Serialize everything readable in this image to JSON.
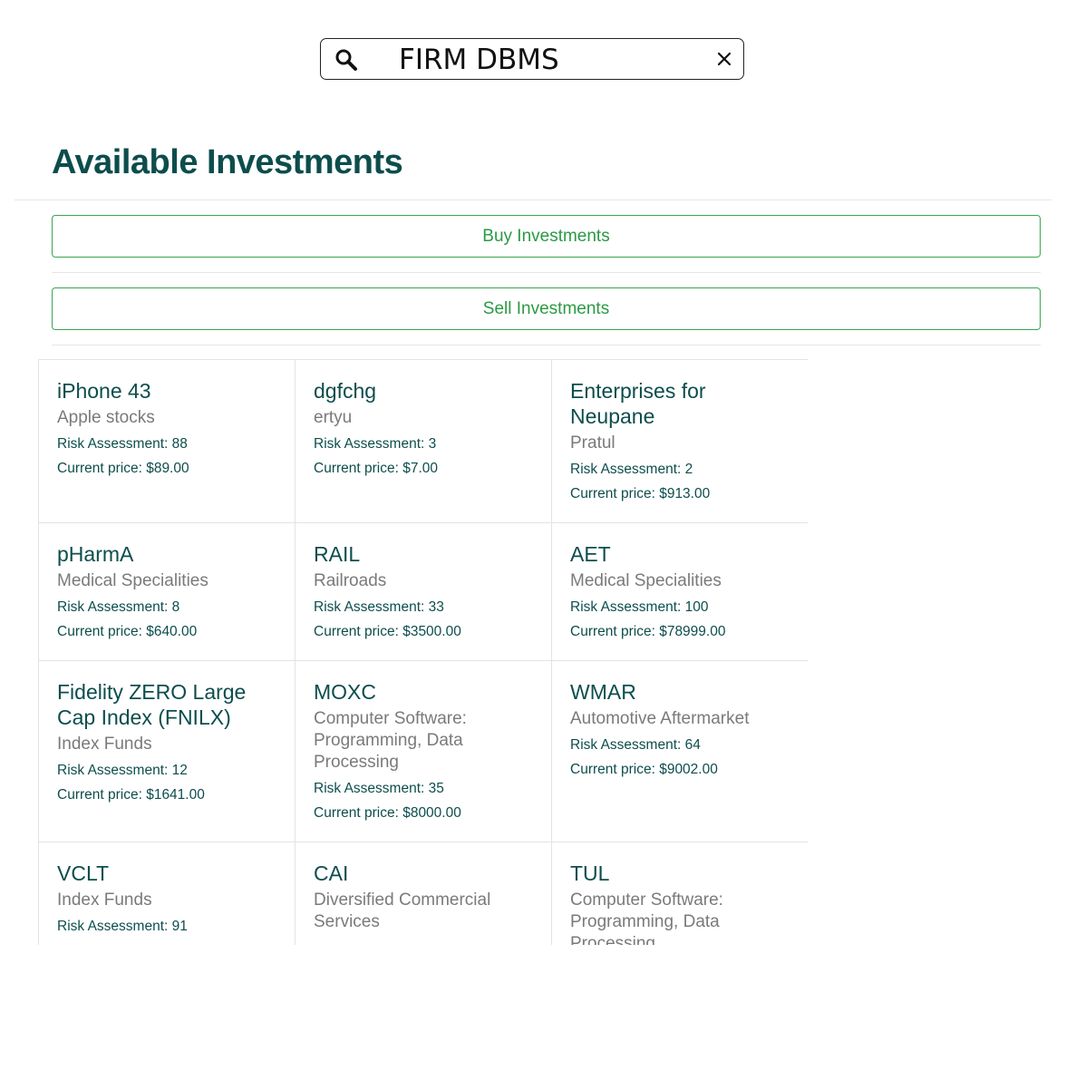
{
  "search": {
    "value": "FIRM DBMS",
    "icon": "search-icon",
    "clear_icon": "close-icon"
  },
  "page": {
    "title": "Available Investments",
    "buy_label": "Buy Investments",
    "sell_label": "Sell Investments"
  },
  "colors": {
    "title": "#0d4d4d",
    "button_accent": "#2a9a44",
    "subtitle": "#7a7a7a"
  },
  "investments": [
    {
      "name": "iPhone 43",
      "category": "Apple stocks",
      "risk": "Risk Assessment: 88",
      "price": "Current price: $89.00"
    },
    {
      "name": "dgfchg",
      "category": "ertyu",
      "risk": "Risk Assessment: 3",
      "price": "Current price: $7.00"
    },
    {
      "name": "Enterprises for Neupane",
      "category": "Pratul",
      "risk": "Risk Assessment: 2",
      "price": "Current price: $913.00"
    },
    {
      "name": "pHarmA",
      "category": "Medical Specialities",
      "risk": "Risk Assessment: 8",
      "price": "Current price: $640.00"
    },
    {
      "name": "RAIL",
      "category": "Railroads",
      "risk": "Risk Assessment: 33",
      "price": "Current price: $3500.00"
    },
    {
      "name": "AET",
      "category": "Medical Specialities",
      "risk": "Risk Assessment: 100",
      "price": "Current price: $78999.00"
    },
    {
      "name": "Fidelity ZERO Large Cap Index (FNILX)",
      "category": "Index Funds",
      "risk": "Risk Assessment: 12",
      "price": "Current price: $1641.00"
    },
    {
      "name": "MOXC",
      "category": "Computer Software: Programming, Data Processing",
      "risk": "Risk Assessment: 35",
      "price": "Current price: $8000.00"
    },
    {
      "name": "WMAR",
      "category": "Automotive Aftermarket",
      "risk": "Risk Assessment: 64",
      "price": "Current price: $9002.00"
    },
    {
      "name": "VCLT",
      "category": "Index Funds",
      "risk": "Risk Assessment: 91",
      "price": ""
    },
    {
      "name": "CAI",
      "category": "Diversified Commercial Services",
      "risk": "",
      "price": ""
    },
    {
      "name": "TUL",
      "category": "Computer Software: Programming, Data Processing",
      "risk": "",
      "price": ""
    }
  ]
}
